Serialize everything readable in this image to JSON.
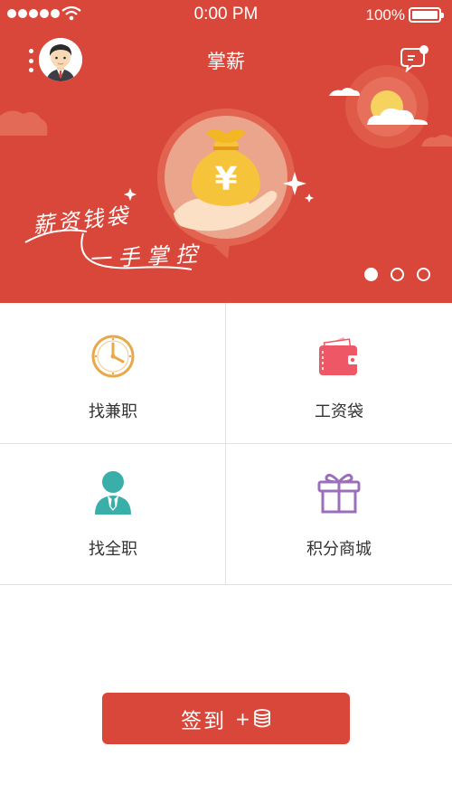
{
  "status_bar": {
    "time": "0:00 PM",
    "battery": "100%"
  },
  "header": {
    "title": "掌薪"
  },
  "banner": {
    "slogan_line1": "薪资钱袋",
    "slogan_line2": "一手掌控",
    "currency_symbol": "¥",
    "slide_count": 3,
    "active_slide": 1
  },
  "grid": {
    "items": [
      {
        "label": "找兼职",
        "icon": "clock-icon",
        "color": "#e9a94a"
      },
      {
        "label": "工资袋",
        "icon": "wallet-icon",
        "color": "#ee5766"
      },
      {
        "label": "找全职",
        "icon": "person-tie-icon",
        "color": "#3aafa9"
      },
      {
        "label": "积分商城",
        "icon": "gift-icon",
        "color": "#9b6fb9"
      }
    ]
  },
  "signin": {
    "label": "签到",
    "plus": "+",
    "icon": "coins-icon"
  },
  "colors": {
    "brand": "#d9473a"
  }
}
